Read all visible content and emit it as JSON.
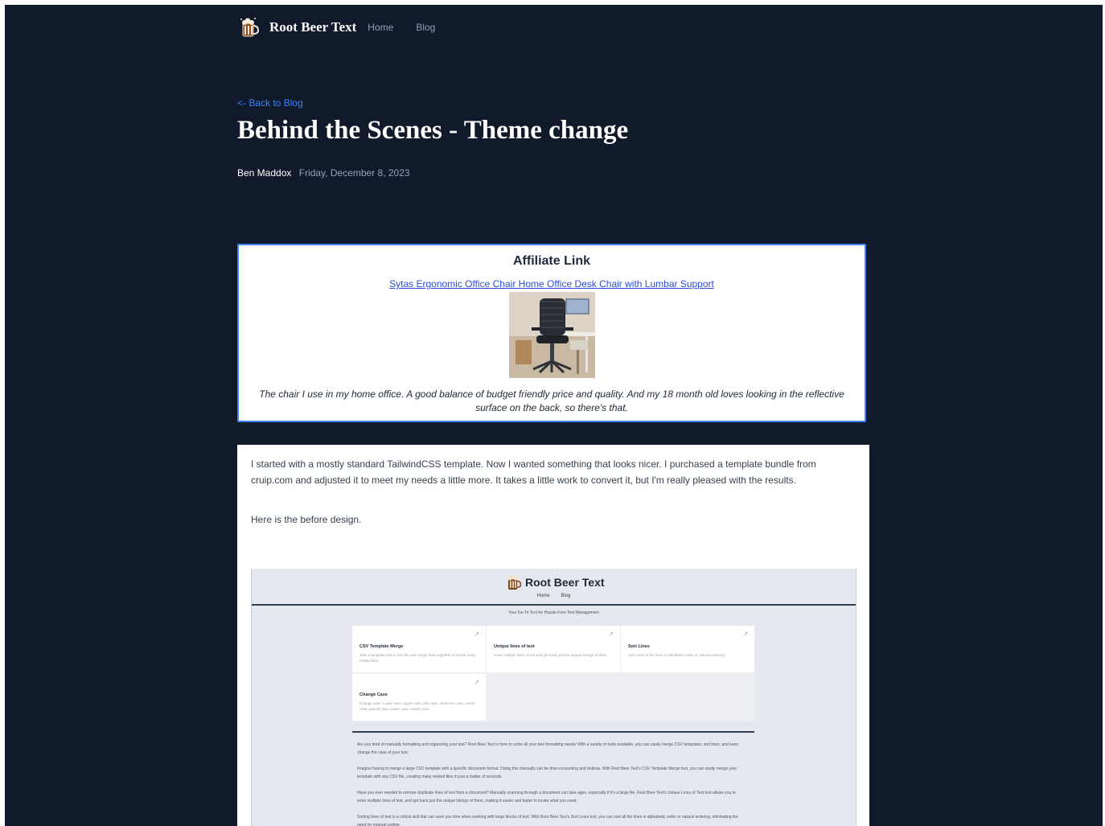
{
  "header": {
    "brand": "Root Beer Text",
    "nav": [
      "Home",
      "Blog"
    ]
  },
  "article": {
    "back_link": "<- Back to Blog",
    "title": "Behind the Scenes - Theme change",
    "author": "Ben Maddox",
    "date": "Friday, December 8, 2023"
  },
  "affiliate": {
    "heading": "Affiliate Link",
    "link_text": "Sytas Ergonomic Office Chair Home Office Desk Chair with Lumbar Support",
    "caption": "The chair I use in my home office. A good balance of budget friendly price and quality. And my 18 month old loves looking in the reflective surface on the back, so there's that."
  },
  "content": {
    "paragraph1": "I started with a mostly standard TailwindCSS template. Now I wanted something that looks nicer. I purchased a template bundle from cruip.com and adjusted it to meet my needs a little more. It takes a little work to convert it, but I'm really pleased with the results.",
    "paragraph2": "Here is the before design."
  },
  "screenshot": {
    "brand": "Root Beer Text",
    "nav": [
      "Home",
      "Blog"
    ],
    "tagline": "Your Go-To Tool for Hassle-Free Text Management",
    "tools": [
      {
        "title": "CSV Template Merge",
        "desc": "Take a template and a CSV file and merge them together to create many related files"
      },
      {
        "title": "Unique lines of text",
        "desc": "Enter multiple lines of text and get back just the unique listings of them"
      },
      {
        "title": "Sort Lines",
        "desc": "Sort Lines of the lines in alphabetic order or natural ordering"
      },
      {
        "title": "Change Case",
        "desc": "Change case. Lower case, upper case, title case, sentence case, camel case, pascal case, snake case, kebab case"
      }
    ],
    "paragraphs": [
      "Are you tired of manually formatting and organizing your text? Root Beer Text is here to solve all your text formatting needs! With a variety of tools available, you can easily merge CSV templates, sort lines, and even change the case of your text.",
      "Imagine having to merge a large CSV template with a specific document format. Doing this manually can be time-consuming and tedious. With Root Beer Text's CSV Template Merge tool, you can easily merge your template with any CSV file, creating many related files in just a matter of seconds.",
      "Have you ever needed to remove duplicate lines of text from a document? Manually scanning through a document can take ages, especially if it's a large file. Root Beer Text's Unique Lines of Text tool allows you to enter multiple lines of text, and get back just the unique listings of them, making it easier and faster to locate what you need.",
      "Sorting lines of text is a critical skill that can save you time when working with large blocks of text. With Root Beer Text's Sort Lines tool, you can sort all the lines in alphabetic order or natural ordering, eliminating the need for manual sorting."
    ]
  }
}
